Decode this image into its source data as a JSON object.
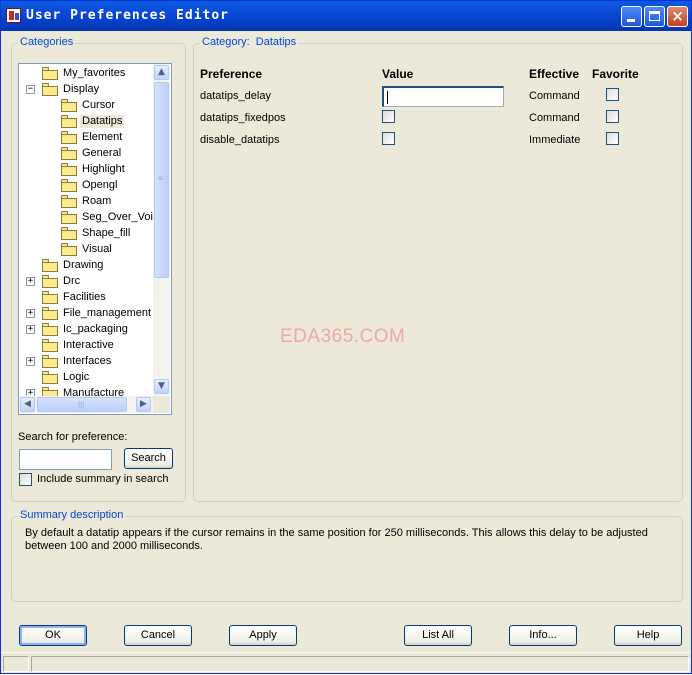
{
  "window": {
    "title": "User Preferences Editor",
    "controls": {
      "minimize": "minimize-icon",
      "maximize": "maximize-icon",
      "close": "close-icon"
    },
    "accent_color": "#0A49D6"
  },
  "categories": {
    "legend": "Categories",
    "tree_items": [
      {
        "label": "My_favorites",
        "level": 1,
        "expander": ""
      },
      {
        "label": "Display",
        "level": 1,
        "expander": "−"
      },
      {
        "label": "Cursor",
        "level": 2,
        "expander": ""
      },
      {
        "label": "Datatips",
        "level": 2,
        "expander": "",
        "selected": true
      },
      {
        "label": "Element",
        "level": 2,
        "expander": ""
      },
      {
        "label": "General",
        "level": 2,
        "expander": ""
      },
      {
        "label": "Highlight",
        "level": 2,
        "expander": ""
      },
      {
        "label": "Opengl",
        "level": 2,
        "expander": ""
      },
      {
        "label": "Roam",
        "level": 2,
        "expander": ""
      },
      {
        "label": "Seg_Over_Voi",
        "level": 2,
        "expander": ""
      },
      {
        "label": "Shape_fill",
        "level": 2,
        "expander": ""
      },
      {
        "label": "Visual",
        "level": 2,
        "expander": ""
      },
      {
        "label": "Drawing",
        "level": 1,
        "expander": ""
      },
      {
        "label": "Drc",
        "level": 1,
        "expander": "+"
      },
      {
        "label": "Facilities",
        "level": 1,
        "expander": ""
      },
      {
        "label": "File_management",
        "level": 1,
        "expander": "+"
      },
      {
        "label": "Ic_packaging",
        "level": 1,
        "expander": "+"
      },
      {
        "label": "Interactive",
        "level": 1,
        "expander": ""
      },
      {
        "label": "Interfaces",
        "level": 1,
        "expander": "+"
      },
      {
        "label": "Logic",
        "level": 1,
        "expander": ""
      },
      {
        "label": "Manufacture",
        "level": 1,
        "expander": "+"
      }
    ],
    "search_label": "Search for preference:",
    "search_value": "",
    "search_button": "Search",
    "include_summary_label": "Include summary in search",
    "include_summary_checked": false
  },
  "category_panel": {
    "legend": "Category:  Datatips",
    "headers": {
      "preference": "Preference",
      "value": "Value",
      "effective": "Effective",
      "favorite": "Favorite"
    },
    "rows": [
      {
        "name": "datatips_delay",
        "value_type": "text",
        "value": "",
        "effective": "Command",
        "favorite": false
      },
      {
        "name": "datatips_fixedpos",
        "value_type": "checkbox",
        "value": false,
        "effective": "Command",
        "favorite": false
      },
      {
        "name": "disable_datatips",
        "value_type": "checkbox",
        "value": false,
        "effective": "Immediate",
        "favorite": false
      }
    ]
  },
  "watermark": "EDA365.COM",
  "summary": {
    "legend": "Summary description",
    "text_line1": "By default a datatip appears if the cursor remains in the same position for 250 milliseconds. This allows this delay to be adjusted",
    "text_line2": "between 100 and 2000 milliseconds."
  },
  "buttons": {
    "ok": "OK",
    "cancel": "Cancel",
    "apply": "Apply",
    "list_all": "List All",
    "info": "Info...",
    "help": "Help"
  }
}
